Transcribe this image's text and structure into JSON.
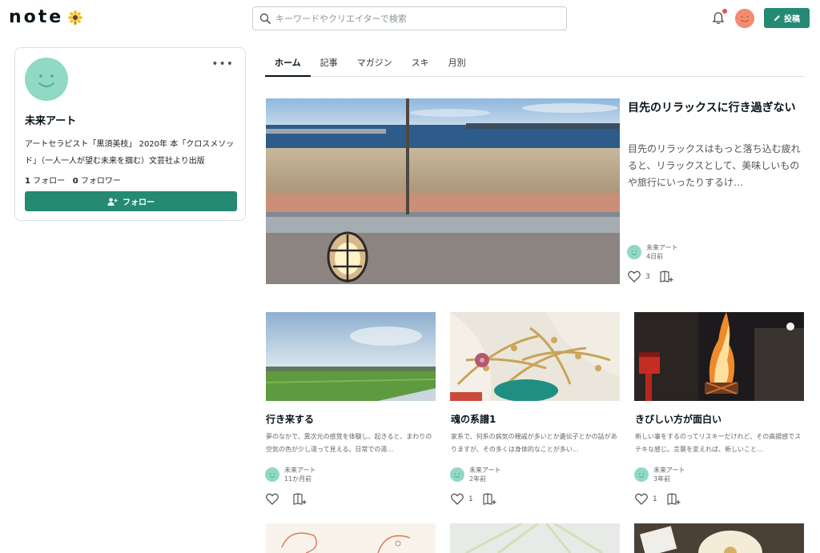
{
  "header": {
    "logo_text": "note",
    "search_placeholder": "キーワードやクリエイターで検索",
    "post_label": "投稿"
  },
  "profile": {
    "name": "未来アート",
    "bio": "アートセラピスト「黒須美枝」 2020年 本「クロスメソッド」（一人一人が望む未来を掴む）文芸社より出版",
    "follow_count": "1",
    "follow_label": "フォロー",
    "follower_count": "0",
    "follower_label": "フォロワー",
    "follow_button": "フォロー",
    "more_icon": "•••"
  },
  "tabs": [
    {
      "label": "ホーム",
      "active": true
    },
    {
      "label": "記事"
    },
    {
      "label": "マガジン"
    },
    {
      "label": "スキ"
    },
    {
      "label": "月別"
    }
  ],
  "featured": {
    "title": "目先のリラックスに行き過ぎない",
    "excerpt": "目先のリラックスはもっと落ち込む疲れると、リラックスとして、美味しいものや旅行にいったりするけ…",
    "author": "未来アート",
    "time": "4日前",
    "likes": "3"
  },
  "articles": [
    {
      "title": "行き来する",
      "excerpt": "夢のなかで、異次元の感覚を体験し、起きると、まわりの空気の色が少し違って見える。日常での違…",
      "author": "未来アート",
      "time": "11か月前",
      "likes": ""
    },
    {
      "title": "魂の系譜1",
      "excerpt": "家系で、何系の病気の親戚が多いとか遺伝子とかの話がありますが、その多くは身体的なことが多い…",
      "author": "未来アート",
      "time": "2年前",
      "likes": "1"
    },
    {
      "title": "きびしい方が面白い",
      "excerpt": "新しい事をするのってリスキーだけれど、その高揚感でステキな感じ。言葉を変えれば、新しいこと…",
      "author": "未来アート",
      "time": "3年前",
      "likes": "1"
    }
  ],
  "colors": {
    "brand_green": "#248a74",
    "avatar_mint": "#8fd9c5",
    "notification_red": "#e7534d"
  }
}
